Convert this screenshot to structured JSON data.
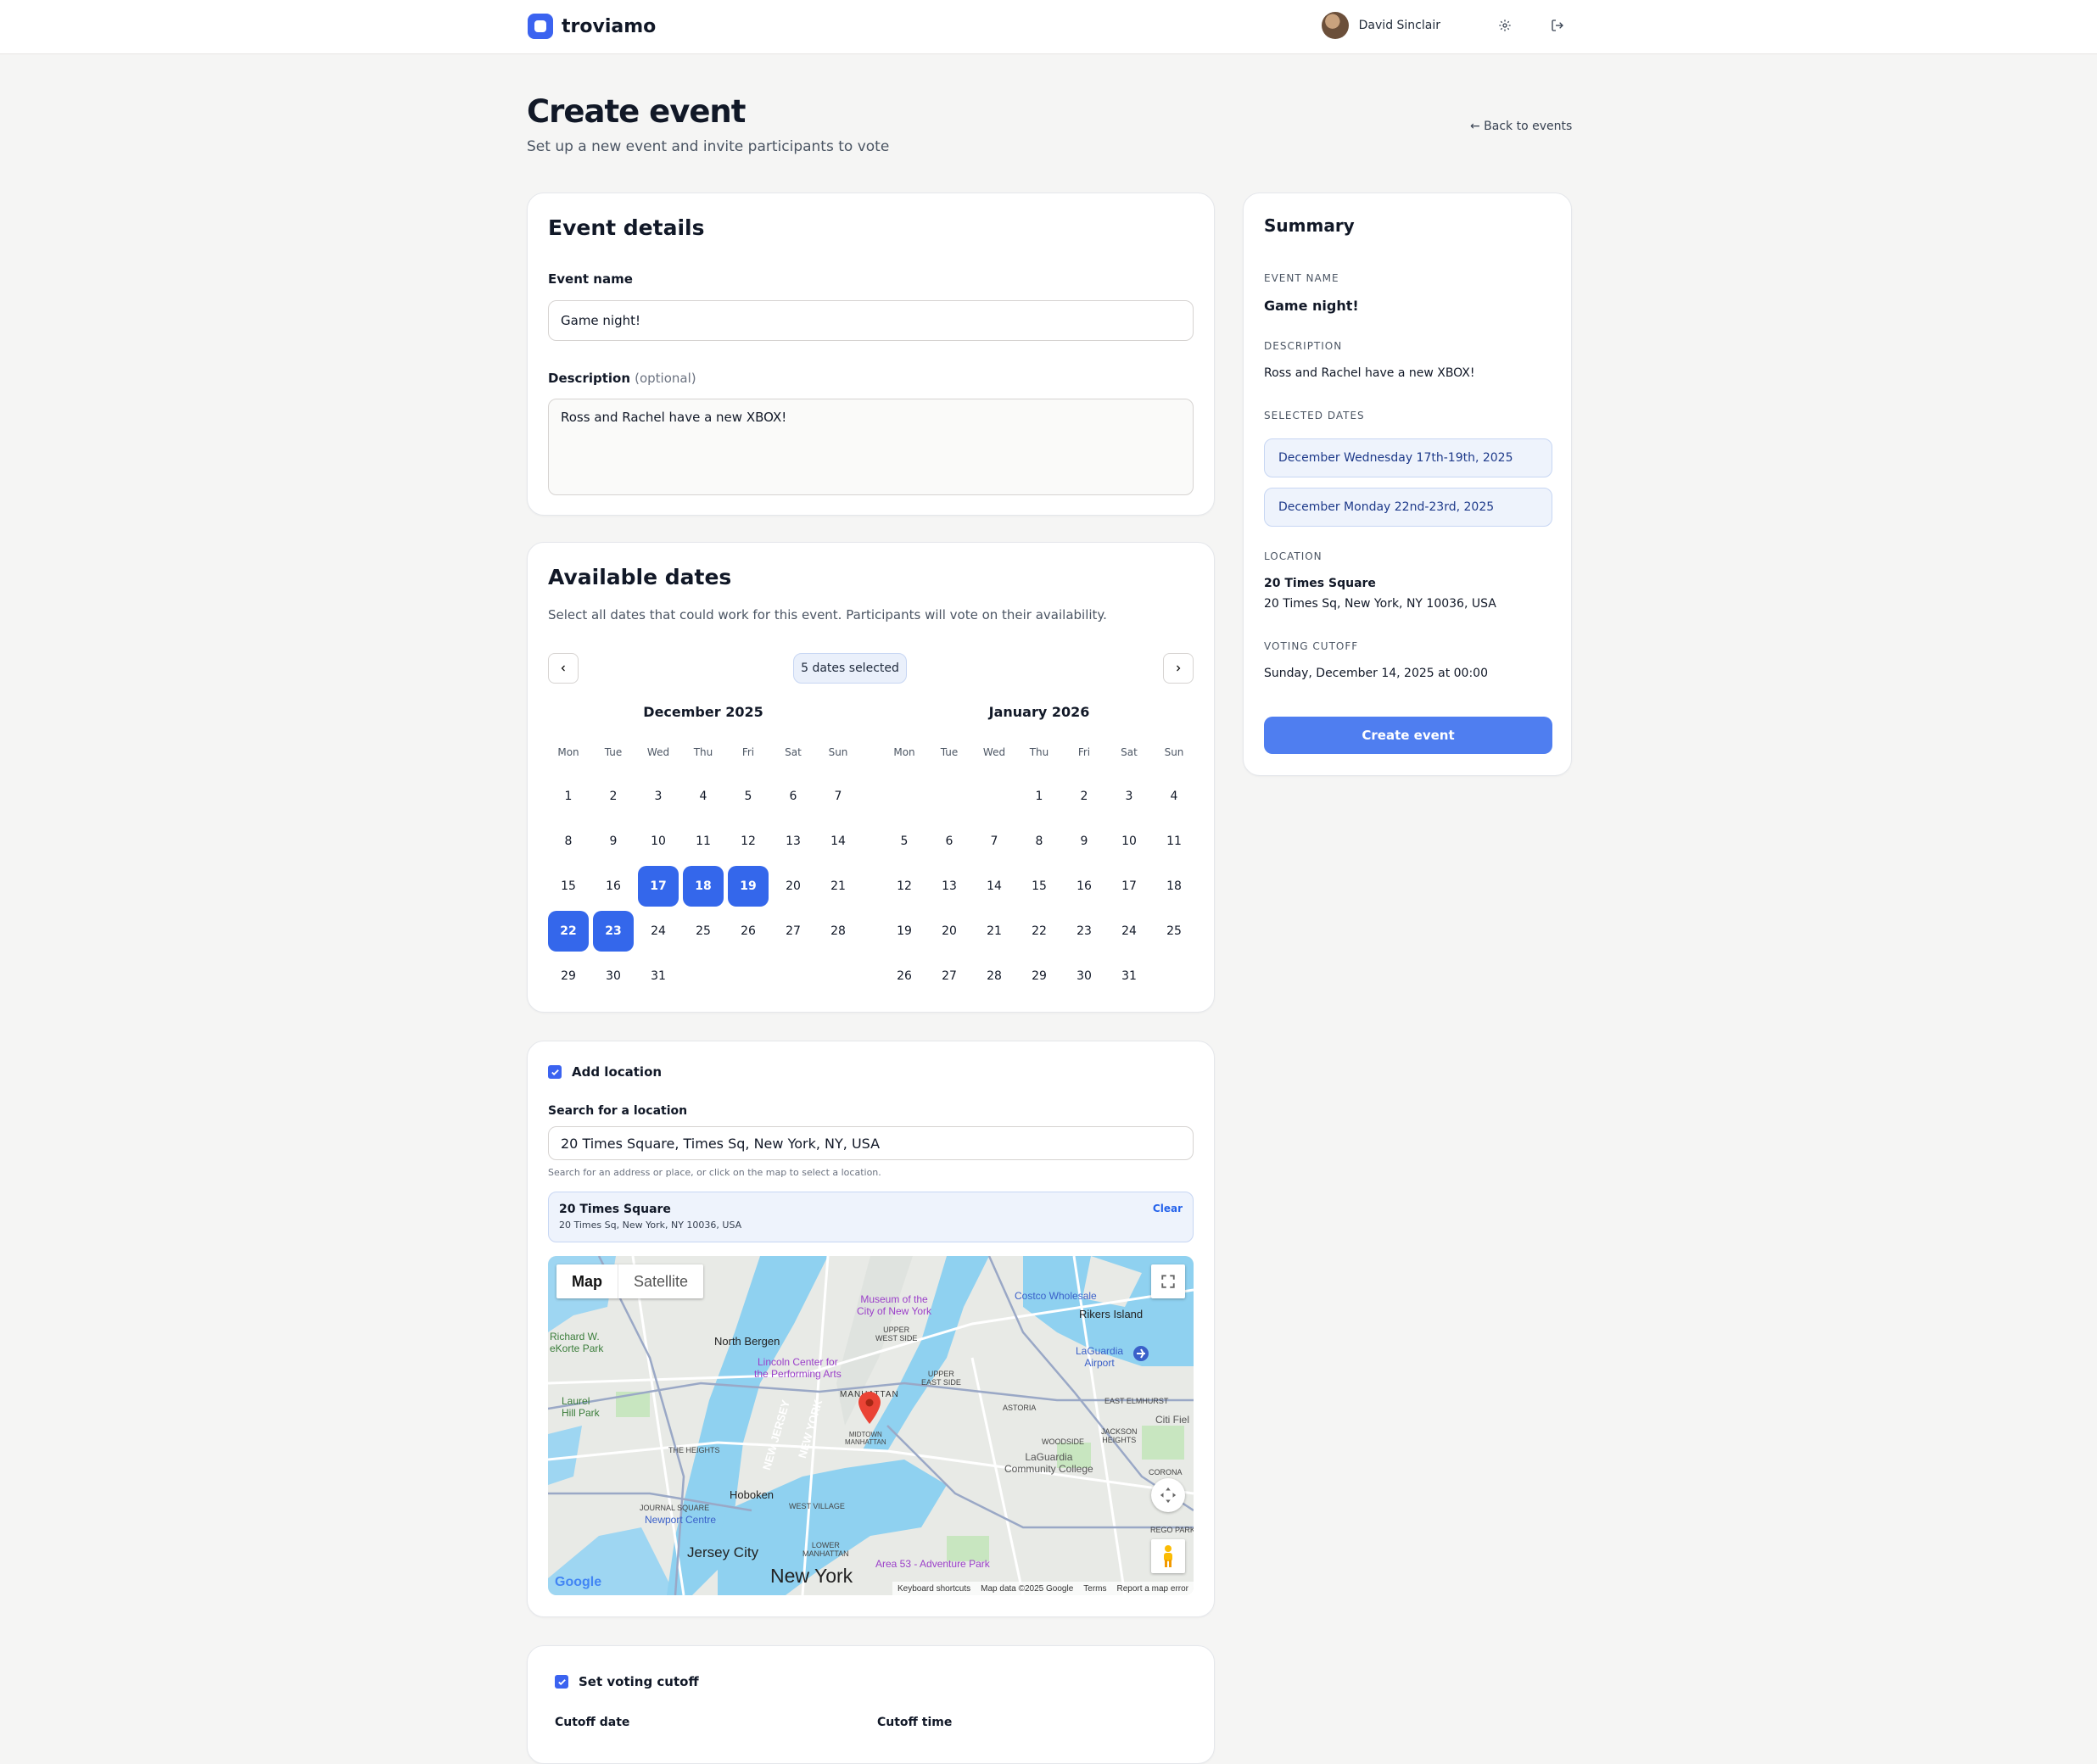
{
  "app": {
    "name": "troviamo"
  },
  "user": {
    "name": "David Sinclair"
  },
  "header": {
    "title": "Create event",
    "subtitle": "Set up a new event and invite participants to vote",
    "back_label": "← Back to events"
  },
  "event_details": {
    "title": "Event details",
    "name_label": "Event name",
    "name_value": "Game night!",
    "description_label": "Description",
    "description_optional": "(optional)",
    "description_value": "Ross and Rachel have a new XBOX!"
  },
  "available_dates": {
    "title": "Available dates",
    "help": "Select all dates that could work for this event. Participants will vote on their availability.",
    "selected_count_label": "5 dates selected",
    "weekdays": [
      "Mon",
      "Tue",
      "Wed",
      "Thu",
      "Fri",
      "Sat",
      "Sun"
    ],
    "months": [
      {
        "title": "December 2025",
        "weeks": [
          [
            "1",
            "2",
            "3",
            "4",
            "5",
            "6",
            "7"
          ],
          [
            "8",
            "9",
            "10",
            "11",
            "12",
            "13",
            "14"
          ],
          [
            "15",
            "16",
            "17",
            "18",
            "19",
            "20",
            "21"
          ],
          [
            "22",
            "23",
            "24",
            "25",
            "26",
            "27",
            "28"
          ],
          [
            "29",
            "30",
            "31",
            "",
            "",
            "",
            ""
          ]
        ],
        "selected": [
          "17",
          "18",
          "19",
          "22",
          "23"
        ]
      },
      {
        "title": "January 2026",
        "weeks": [
          [
            "",
            "",
            "",
            "1",
            "2",
            "3",
            "4"
          ],
          [
            "5",
            "6",
            "7",
            "8",
            "9",
            "10",
            "11"
          ],
          [
            "12",
            "13",
            "14",
            "15",
            "16",
            "17",
            "18"
          ],
          [
            "19",
            "20",
            "21",
            "22",
            "23",
            "24",
            "25"
          ],
          [
            "26",
            "27",
            "28",
            "29",
            "30",
            "31",
            ""
          ]
        ],
        "selected": []
      }
    ]
  },
  "location": {
    "toggle_label": "Add location",
    "search_label": "Search for a location",
    "search_value": "20 Times Square, Times Sq, New York, NY, USA",
    "search_help": "Search for an address or place, or click on the map to select a location.",
    "selected_name": "20 Times Square",
    "selected_address": "20 Times Sq, New York, NY 10036, USA",
    "clear_label": "Clear",
    "map": {
      "tab_map": "Map",
      "tab_satellite": "Satellite",
      "labels": {
        "north_bergen": "North Bergen",
        "richard_park": "Richard W.\neKorte Park",
        "laurel_hill": "Laurel\nHill Park",
        "museum": "Museum of the\nCity of New York",
        "lincoln": "Lincoln Center for\nthe Performing Arts",
        "upper_west": "UPPER\nWEST SIDE",
        "upper_east": "UPPER\nEAST SIDE",
        "manhattan": "MANHATTAN",
        "midtown": "MIDTOWN\nMANHATTAN",
        "costco": "Costco Wholesale",
        "rikers": "Rikers Island",
        "laguardia_airport": "LaGuardia\nAirport",
        "astoria": "ASTORIA",
        "east_elmhurst": "EAST ELMHURST",
        "jackson_heights": "JACKSON\nHEIGHTS",
        "woodside": "WOODSIDE",
        "laguardia_college": "LaGuardia\nCommunity College",
        "corona": "CORONA",
        "the_heights": "THE HEIGHTS",
        "hoboken": "Hoboken",
        "journal_square": "JOURNAL SQUARE",
        "newport": "Newport Centre",
        "west_village": "WEST VILLAGE",
        "jersey_city": "Jersey City",
        "lower_manhattan": "LOWER\nMANHATTAN",
        "area53": "Area 53 - Adventure Park",
        "new_york": "New York",
        "new_jersey": "NEW JERSEY",
        "new_york_state": "NEW YORK",
        "rego_park": "REGO PARK",
        "citi_field": "Citi Fiel"
      },
      "google": "Google",
      "attribution": [
        "Keyboard shortcuts",
        "Map data ©2025 Google",
        "Terms",
        "Report a map error"
      ]
    }
  },
  "voting_cutoff": {
    "toggle_label": "Set voting cutoff",
    "date_label": "Cutoff date",
    "time_label": "Cutoff time"
  },
  "summary": {
    "title": "Summary",
    "event_name_label": "EVENT NAME",
    "event_name_value": "Game night!",
    "description_label": "DESCRIPTION",
    "description_value": "Ross and Rachel have a new XBOX!",
    "selected_dates_label": "SELECTED DATES",
    "selected_dates": [
      "December Wednesday 17th-19th, 2025",
      "December Monday 22nd-23rd, 2025"
    ],
    "location_label": "LOCATION",
    "location_name": "20 Times Square",
    "location_address": "20 Times Sq, New York, NY 10036, USA",
    "cutoff_label": "VOTING CUTOFF",
    "cutoff_value": "Sunday, December 14, 2025 at 00:00",
    "create_label": "Create event"
  },
  "colors": {
    "accent": "#3467eb",
    "button": "#4f7ef0",
    "chip_bg": "#eef3fc",
    "water": "#8fd1f0",
    "park": "#c8e6c0"
  },
  "icons": [
    "gear-icon",
    "logout-icon",
    "chevron-left-icon",
    "chevron-right-icon",
    "check-icon",
    "map-pin-icon",
    "fullscreen-icon",
    "pegman-icon",
    "camera-control-icon",
    "airport-icon"
  ]
}
